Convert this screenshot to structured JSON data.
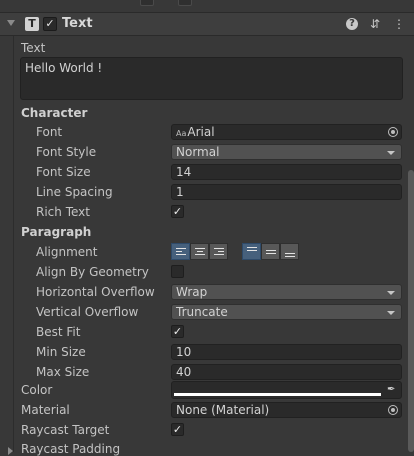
{
  "component": {
    "title": "Text",
    "enabled": true,
    "icons": [
      "text-component-icon",
      "help-icon",
      "presets-icon",
      "context-menu-icon"
    ]
  },
  "text": {
    "label": "Text",
    "value": "Hello World !"
  },
  "character": {
    "section_label": "Character",
    "font": {
      "label": "Font",
      "value": "Arial",
      "icon": "font-asset-icon"
    },
    "font_style": {
      "label": "Font Style",
      "value": "Normal"
    },
    "font_size": {
      "label": "Font Size",
      "value": "14"
    },
    "line_spacing": {
      "label": "Line Spacing",
      "value": "1"
    },
    "rich_text": {
      "label": "Rich Text",
      "checked": true
    }
  },
  "paragraph": {
    "section_label": "Paragraph",
    "alignment": {
      "label": "Alignment",
      "horizontal": [
        "left",
        "center",
        "right"
      ],
      "vertical": [
        "top",
        "middle",
        "bottom"
      ],
      "selected_horizontal": "left",
      "selected_vertical": "top"
    },
    "align_by_geometry": {
      "label": "Align By Geometry",
      "checked": false
    },
    "horizontal_overflow": {
      "label": "Horizontal Overflow",
      "value": "Wrap"
    },
    "vertical_overflow": {
      "label": "Vertical Overflow",
      "value": "Truncate"
    },
    "best_fit": {
      "label": "Best Fit",
      "checked": true
    },
    "min_size": {
      "label": "Min Size",
      "value": "10"
    },
    "max_size": {
      "label": "Max Size",
      "value": "40"
    }
  },
  "color": {
    "label": "Color",
    "value": "#ffffff"
  },
  "material": {
    "label": "Material",
    "value": "None (Material)"
  },
  "raycast_target": {
    "label": "Raycast Target",
    "checked": true
  },
  "raycast_padding": {
    "label": "Raycast Padding"
  },
  "check_glyph": "✓"
}
